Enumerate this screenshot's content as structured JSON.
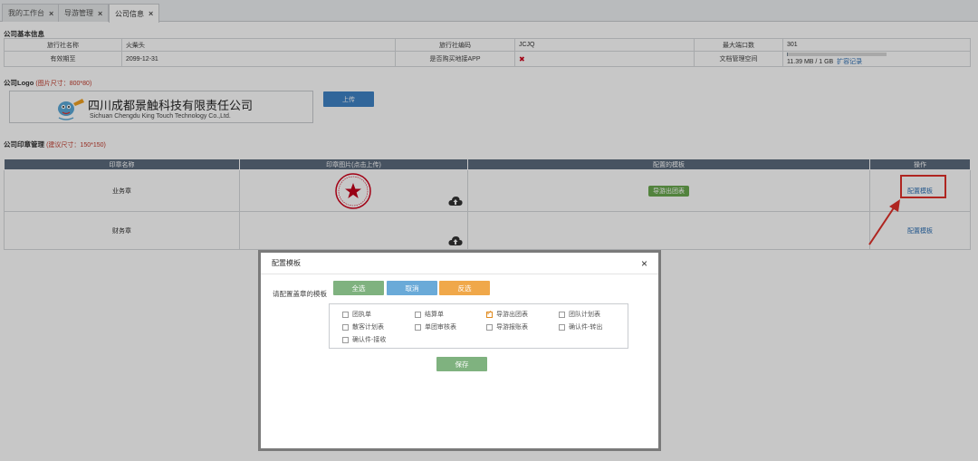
{
  "tabs": [
    {
      "label": "我的工作台",
      "close": "×"
    },
    {
      "label": "导游管理",
      "close": "×"
    },
    {
      "label": "公司信息",
      "close": "×"
    }
  ],
  "basic": {
    "title": "公司基本信息",
    "agency_name_label": "旅行社名称",
    "agency_name_value": "火柴头",
    "agency_code_label": "旅行社编码",
    "agency_code_value": "JCJQ",
    "max_ports_label": "最大端口数",
    "max_ports_value": "301",
    "expiry_label": "有效期至",
    "expiry_value": "2099-12-31",
    "app_label": "是否购买地接APP",
    "app_value": "✖",
    "storage_label": "文档管理空间",
    "storage_value": "11.39 MB / 1 GB",
    "storage_fraction": 0.011,
    "expand_link": "扩容记录"
  },
  "logo": {
    "title": "公司Logo",
    "hint": "(图片尺寸：800*80)",
    "company_cn": "四川成都景触科技有限责任公司",
    "company_en": "Sichuan Chengdu King Touch Technology Co.,Ltd.",
    "upload_label": "上传"
  },
  "seal": {
    "title": "公司印章管理",
    "hint": "(建议尺寸：150*150)",
    "headers": [
      "印章名称",
      "印章图片(点击上传)",
      "配置的模板",
      "操作"
    ],
    "rows": [
      {
        "name": "业务章",
        "template_tag": "导游出团表",
        "action": "配置模板"
      },
      {
        "name": "财务章",
        "template_tag": "",
        "action": "配置模板"
      }
    ]
  },
  "modal": {
    "title": "配置模板",
    "close": "×",
    "prompt": "请配置盖章的模板",
    "btn_all": "全选",
    "btn_cancel": "取消",
    "btn_invert": "反选",
    "options": [
      {
        "label": "团执单",
        "checked": false
      },
      {
        "label": "结算单",
        "checked": false
      },
      {
        "label": "导游出团表",
        "checked": true
      },
      {
        "label": "团队计划表",
        "checked": false
      },
      {
        "label": "散客计划表",
        "checked": false
      },
      {
        "label": "单团审核表",
        "checked": false
      },
      {
        "label": "导游报账表",
        "checked": false
      },
      {
        "label": "确认件-转出",
        "checked": false
      },
      {
        "label": "确认件-接收",
        "checked": false
      }
    ],
    "save_label": "保存"
  },
  "colors": {
    "header_bg": "#5b6b7d",
    "upload_btn": "#3f83c6",
    "btn_all": "#7fb27f",
    "btn_cancel": "#6aaad8",
    "btn_invert": "#f0a84a",
    "btn_save": "#7fb27f",
    "highlight_red": "#e0302a",
    "tag_green": "#6aa84f"
  }
}
